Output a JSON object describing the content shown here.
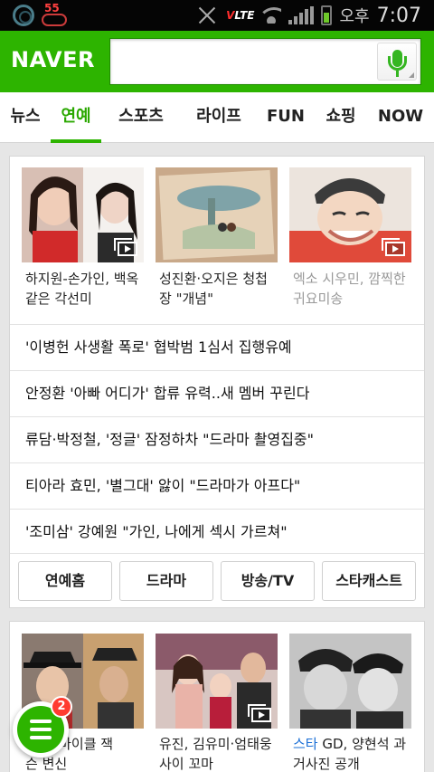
{
  "status_bar": {
    "badge_number": "55",
    "network": "LTE",
    "ampm": "오후",
    "time": "7:07"
  },
  "header": {
    "logo": "NAVER",
    "search": {
      "value": "",
      "placeholder": ""
    },
    "icons": [
      "voice-search-icon"
    ]
  },
  "tabs": [
    {
      "label": "뉴스",
      "active": false
    },
    {
      "label": "연예",
      "active": true
    },
    {
      "label": "스포츠",
      "active": false
    },
    {
      "label": "라이프",
      "active": false
    },
    {
      "label": "FUN",
      "active": false
    },
    {
      "label": "쇼핑",
      "active": false
    },
    {
      "label": "NOW",
      "active": false
    }
  ],
  "card1": {
    "photos": [
      {
        "caption_line1": "하지원-손가인, 백옥",
        "caption_line2": "같은 각선미",
        "video": true,
        "read": false
      },
      {
        "caption_line1": "성진환·오지은 청첩",
        "caption_line2": "장 \"개념\"",
        "video": false,
        "read": false
      },
      {
        "caption_line1": "엑소 시우민, 깜찍한",
        "caption_line2": "귀요미송",
        "video": true,
        "read": true
      }
    ],
    "headlines": [
      "'이병헌 사생활 폭로' 협박범 1심서 집행유예",
      "안정환 '아빠 어디가' 합류 유력..새 멤버 꾸린다",
      "류담·박정철, '정글' 잠정하차 \"드라마 촬영집중\"",
      "티아라 효민, '별그대' 앓이 \"드라마가 아프다\"",
      "'조미삼' 강예원 \"가인, 나에게 섹시 가르쳐\""
    ],
    "categories": [
      "연예홈",
      "드라마",
      "방송/TV",
      "스타캐스트"
    ]
  },
  "card2": {
    "photos": [
      {
        "caption_line1": "태양, 마이클 잭",
        "caption_line2": "슨 변신",
        "video": false
      },
      {
        "caption_line1": "유진, 김유미·엄태웅",
        "caption_line2": "사이 꼬마",
        "video": true
      },
      {
        "caption_prefix": "스타",
        "caption_line1": " GD, 양현석 과",
        "caption_line2": "거사진 공개",
        "video": false
      }
    ]
  },
  "menu_button": {
    "badge": "2"
  },
  "colors": {
    "brand_green": "#2db400",
    "tab_active": "#2aa800",
    "link_blue": "#1a6fd6",
    "badge_red": "#ff3b30"
  }
}
